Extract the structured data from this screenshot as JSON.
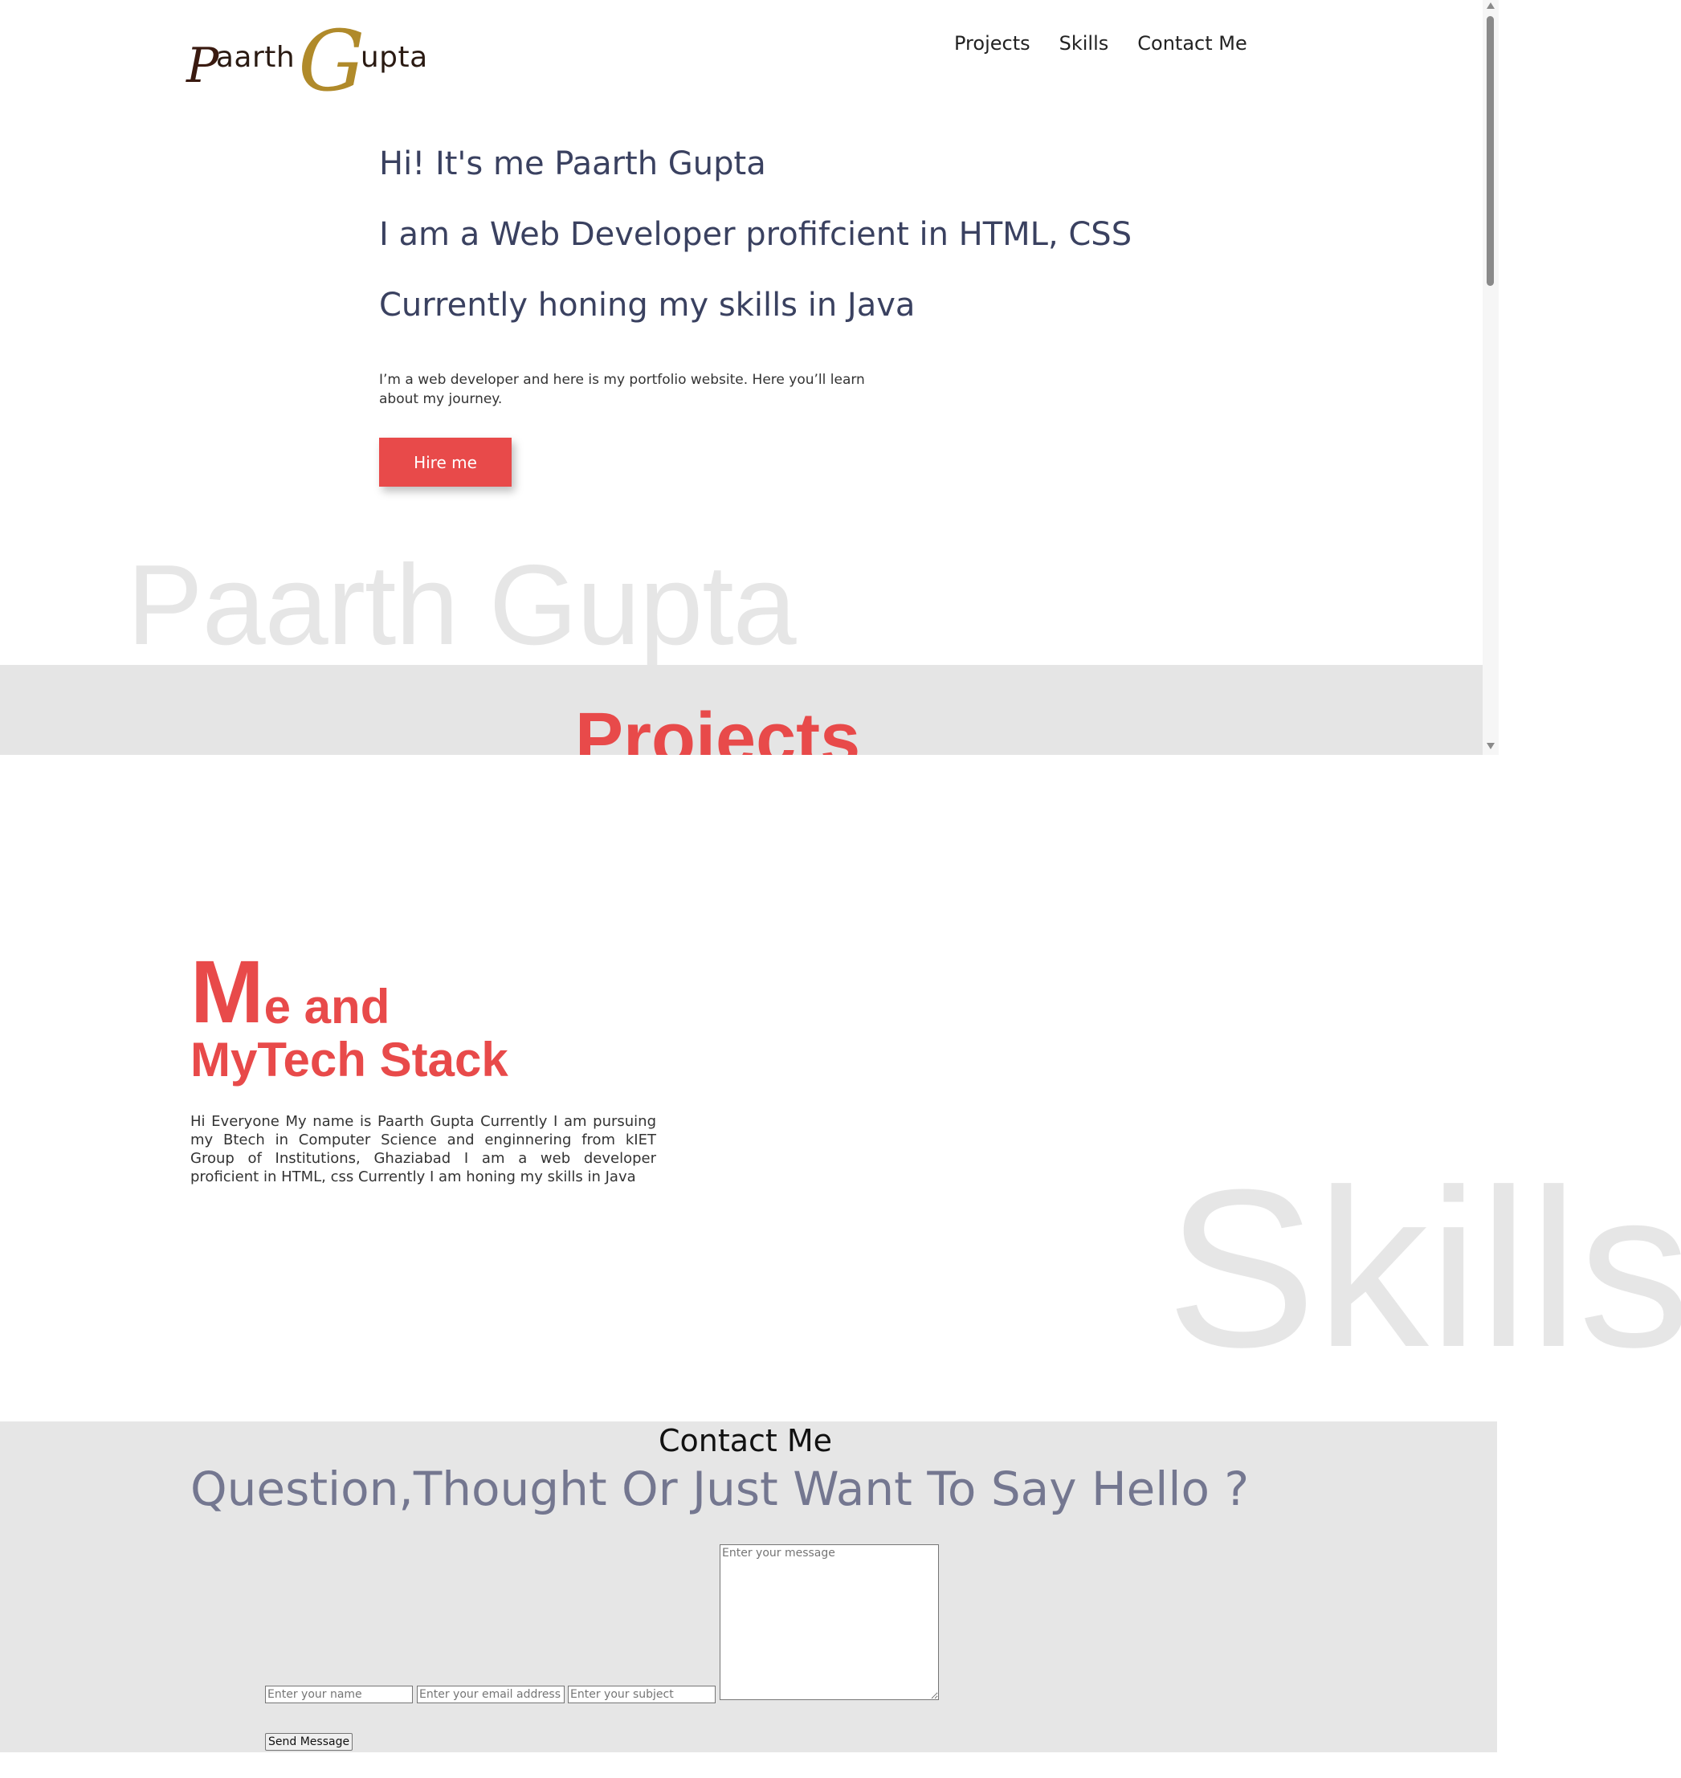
{
  "logo": {
    "initial_p": "P",
    "rest_first": "aarth",
    "initial_g": "G",
    "rest_last": "upta",
    "alt": "Paarth Gupta"
  },
  "nav": {
    "items": [
      {
        "label": "Projects"
      },
      {
        "label": "Skills"
      },
      {
        "label": "Contact Me"
      }
    ]
  },
  "hero": {
    "lines": [
      "Hi! It's me Paarth Gupta",
      "I am a Web Developer profifcient in HTML, CSS",
      "Currently honing my skills in Java"
    ],
    "description": "I’m a web developer and here is my portfolio website. Here you’ll learn about my journey.",
    "hire_button": "Hire me",
    "background_name": "Paarth Gupta"
  },
  "projects": {
    "title": "Projects"
  },
  "about": {
    "title_first_letter": "M",
    "title_rest_line1": "e and",
    "title_line2": "MyTech Stack",
    "description": "Hi Everyone My name is Paarth Gupta Currently I am pursuing my Btech in Computer Science and enginnering from kIET Group of Institutions, Ghaziabad I am a web developer proficient in HTML, css Currently I am honing my skills in Java",
    "background_word": "Skills"
  },
  "contact": {
    "heading": "Contact Me",
    "subheading": "Question,Thought Or Just Want To Say Hello ?",
    "name_placeholder": "Enter your name",
    "email_placeholder": "Enter your email address",
    "subject_placeholder": "Enter your subject",
    "message_placeholder": "Enter your message",
    "send_button": "Send Message"
  },
  "colors": {
    "accent": "#e84a4a",
    "hero_text": "#3a4160",
    "subheading_text": "#747790",
    "band_background": "#e5e5e5",
    "watermark_text": "#e6e6e6"
  }
}
